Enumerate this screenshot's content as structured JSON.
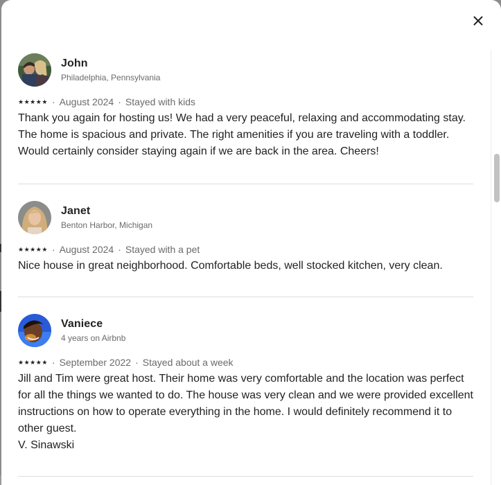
{
  "modal": {
    "close_label": "×"
  },
  "reviews": [
    {
      "name": "John",
      "subtitle": "Philadelphia, Pennsylvania",
      "rating": 5,
      "date": "August 2024",
      "stay": "Stayed with kids",
      "text": "Thank you again for hosting us! We had a very peaceful, relaxing and accommodating stay. The home is spacious and private. The right amenities if you are traveling with a toddler. Would certainly consider staying again if we are back in the area. Cheers!"
    },
    {
      "name": "Janet",
      "subtitle": "Benton Harbor, Michigan",
      "rating": 5,
      "date": "August 2024",
      "stay": "Stayed with a pet",
      "text": "Nice house in great neighborhood. Comfortable beds, well stocked kitchen, very clean."
    },
    {
      "name": "Vaniece",
      "subtitle": "4 years on Airbnb",
      "rating": 5,
      "date": "September 2022",
      "stay": "Stayed about a week",
      "text": "Jill and Tim were great host. Their home was very comfortable and the location was perfect for  all the things we wanted to do. The house was very clean and we were provided excellent  instructions on how to operate everything  in the home. I would definitely  recommend it to other guest.\nV. Sinawski"
    }
  ],
  "colors": {
    "text_primary": "#222222",
    "text_secondary": "#6a6a6a",
    "divider": "#dddddd",
    "backdrop": "#8c8c8c"
  },
  "icons": {
    "close": "close-icon",
    "star": "star-icon"
  }
}
